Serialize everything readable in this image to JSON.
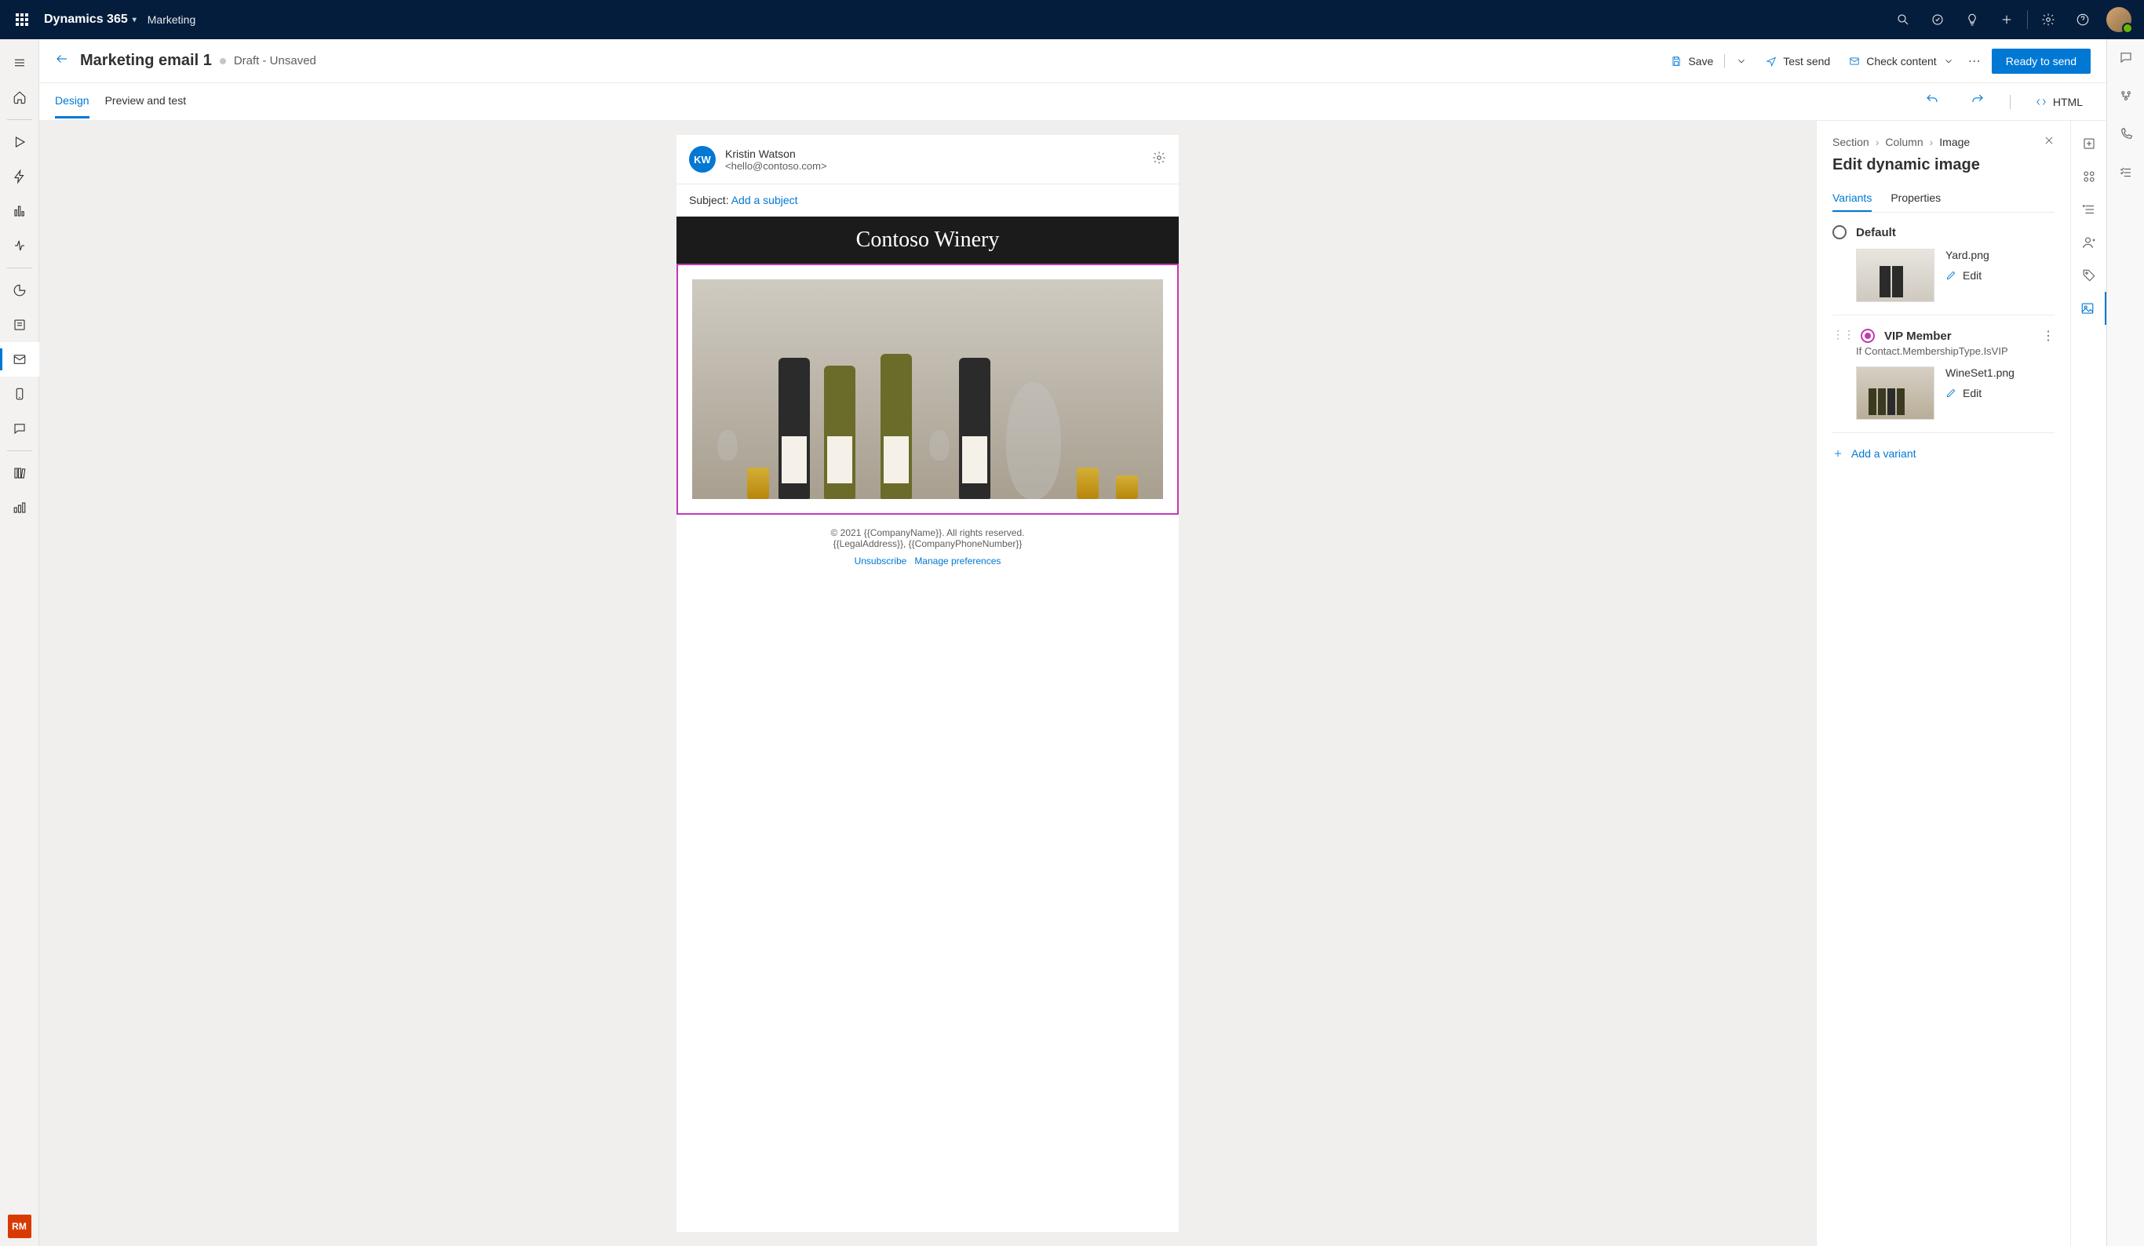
{
  "topbar": {
    "brand": "Dynamics 365",
    "app": "Marketing"
  },
  "commandbar": {
    "title": "Marketing email 1",
    "status": "Draft - Unsaved",
    "save": "Save",
    "test_send": "Test send",
    "check_content": "Check content",
    "primary": "Ready to send"
  },
  "tabs": {
    "design": "Design",
    "preview": "Preview and test",
    "html": "HTML"
  },
  "email": {
    "sender_initials": "KW",
    "sender_name": "Kristin Watson",
    "sender_email": "<hello@contoso.com>",
    "subject_label": "Subject: ",
    "subject_placeholder": "Add a subject",
    "banner": "Contoso Winery",
    "footer_line1": "© 2021 {{CompanyName}}. All rights reserved.",
    "footer_line2": "{{LegalAddress}}, {{CompanyPhoneNumber}}",
    "unsubscribe": "Unsubscribe",
    "manage_prefs": "Manage preferences"
  },
  "panel": {
    "crumb1": "Section",
    "crumb2": "Column",
    "crumb3": "Image",
    "title": "Edit dynamic image",
    "tab_variants": "Variants",
    "tab_properties": "Properties",
    "add_variant": "Add a variant",
    "edit_label": "Edit",
    "variants": [
      {
        "name": "Default",
        "file": "Yard.png",
        "selected": false,
        "condition": ""
      },
      {
        "name": "VIP Member",
        "file": "WineSet1.png",
        "selected": true,
        "condition": "If Contact.MembershipType.IsVIP"
      }
    ]
  },
  "leftnav_rm": "RM"
}
